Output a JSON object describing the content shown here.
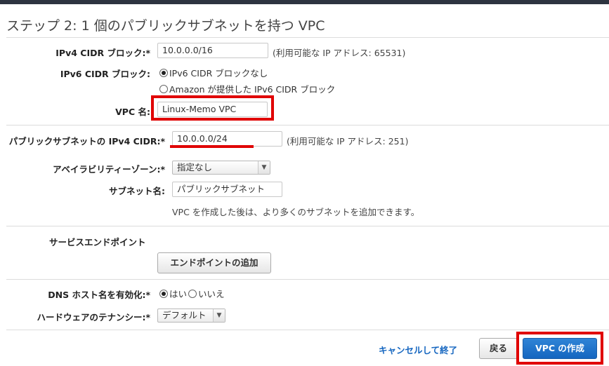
{
  "title": "ステップ 2: 1 個のパブリックサブネットを持つ VPC",
  "ipv4_cidr": {
    "label": "IPv4 CIDR ブロック:*",
    "value": "10.0.0.0/16",
    "note": "(利用可能な IP アドレス: 65531)"
  },
  "ipv6_cidr": {
    "label": "IPv6 CIDR ブロック:",
    "options": [
      "IPv6 CIDR ブロックなし",
      "Amazon が提供した IPv6 CIDR ブロック"
    ],
    "selected_index": 0
  },
  "vpc_name": {
    "label": "VPC 名:",
    "value": "Linux-Memo VPC"
  },
  "subnet_cidr": {
    "label": "パブリックサブネットの IPv4 CIDR:*",
    "value": "10.0.0.0/24",
    "note": "(利用可能な IP アドレス: 251)"
  },
  "availability_zone": {
    "label": "アベイラビリティーゾーン:*",
    "value": "指定なし"
  },
  "subnet_name": {
    "label": "サブネット名:",
    "value": "パブリックサブネット",
    "help": "VPC を作成した後は、より多くのサブネットを追加できます。"
  },
  "service_endpoints": {
    "label": "サービスエンドポイント",
    "add_button": "エンドポイントの追加"
  },
  "dns_hostnames": {
    "label": "DNS ホスト名を有効化:*",
    "options": [
      "はい",
      "いいえ"
    ],
    "selected_index": 0
  },
  "tenancy": {
    "label": "ハードウェアのテナンシー:*",
    "value": "デフォルト"
  },
  "footer": {
    "cancel_link": "キャンセルして終了",
    "back_button": "戻る",
    "create_button": "VPC の作成"
  },
  "colors": {
    "highlight": "#e00000",
    "primary": "#1566c0",
    "link": "#1566c0"
  }
}
